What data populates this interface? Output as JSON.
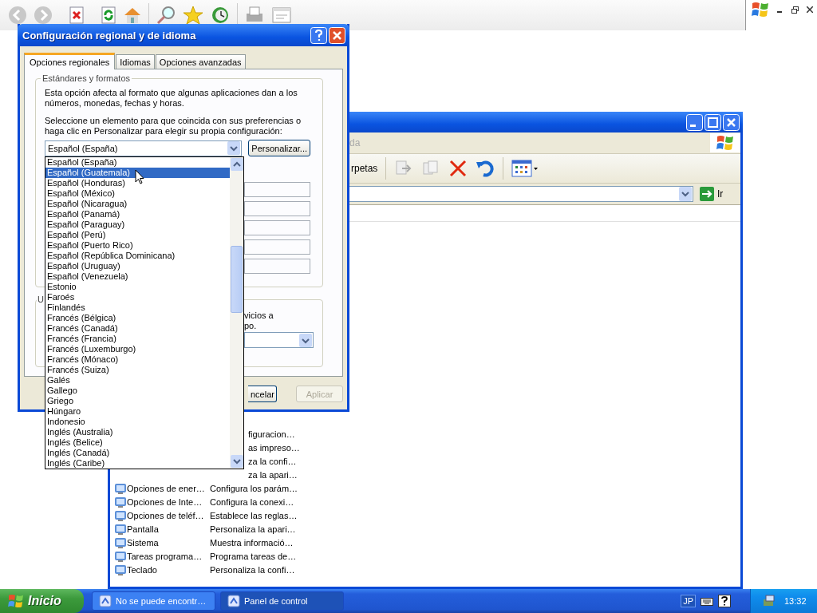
{
  "control_panel": {
    "menu_fragment": "da",
    "toolbar_fragment": "rpetas",
    "go_button": "Ir",
    "items": [
      {
        "kind": "covered",
        "description": "figuracion…"
      },
      {
        "kind": "covered",
        "description": "as impreso…"
      },
      {
        "kind": "covered",
        "description": "za la confi…"
      },
      {
        "kind": "covered",
        "description": "za la apari…"
      },
      {
        "kind": "full",
        "name": "Opciones de ener…",
        "description": "Configura los parám…"
      },
      {
        "kind": "full",
        "name": "Opciones de Inte…",
        "description": "Configura la conexi…"
      },
      {
        "kind": "full",
        "name": "Opciones de teléf…",
        "description": "Establece las reglas…"
      },
      {
        "kind": "full",
        "name": "Pantalla",
        "description": "Personaliza la apari…"
      },
      {
        "kind": "full",
        "name": "Sistema",
        "description": "Muestra informació…"
      },
      {
        "kind": "full",
        "name": "Tareas programa…",
        "description": "Programa tareas de…"
      },
      {
        "kind": "full",
        "name": "Teclado",
        "description": "Personaliza la confi…"
      }
    ]
  },
  "dialog": {
    "title": "Configuración regional y de idioma",
    "tabs": [
      {
        "label": "Opciones regionales",
        "selected": true
      },
      {
        "label": "Idiomas",
        "selected": false
      },
      {
        "label": "Opciones avanzadas",
        "selected": false
      }
    ],
    "group_title": "Estándares y formatos",
    "description": "Esta opción afecta al formato que algunas aplicaciones dan a los números, monedas, fechas y horas.",
    "instruction": "Seleccione un elemento para que coincida con sus preferencias o haga clic en Personalizar para elegir su propia configuración:",
    "locale_value": "Español (España)",
    "customize_button": "Personalizar...",
    "location_legend": "U",
    "location_text": [
      "vicios a",
      "po."
    ],
    "buttons": [
      {
        "label": "ncelar",
        "disabled": false
      },
      {
        "label": "Aplicar",
        "disabled": true
      }
    ]
  },
  "dropdown": {
    "items": [
      {
        "label": "Español (España)",
        "selected": false
      },
      {
        "label": "Español (Guatemala)",
        "selected": true
      },
      {
        "label": "Español (Honduras)",
        "selected": false
      },
      {
        "label": "Español (México)",
        "selected": false
      },
      {
        "label": "Español (Nicaragua)",
        "selected": false
      },
      {
        "label": "Español (Panamá)",
        "selected": false
      },
      {
        "label": "Español (Paraguay)",
        "selected": false
      },
      {
        "label": "Español (Perú)",
        "selected": false
      },
      {
        "label": "Español (Puerto Rico)",
        "selected": false
      },
      {
        "label": "Español (República Dominicana)",
        "selected": false
      },
      {
        "label": "Español (Uruguay)",
        "selected": false
      },
      {
        "label": "Español (Venezuela)",
        "selected": false
      },
      {
        "label": "Estonio",
        "selected": false
      },
      {
        "label": "Faroés",
        "selected": false
      },
      {
        "label": "Finlandés",
        "selected": false
      },
      {
        "label": "Francés (Bélgica)",
        "selected": false
      },
      {
        "label": "Francés (Canadá)",
        "selected": false
      },
      {
        "label": "Francés (Francia)",
        "selected": false
      },
      {
        "label": "Francés (Luxemburgo)",
        "selected": false
      },
      {
        "label": "Francés (Mónaco)",
        "selected": false
      },
      {
        "label": "Francés (Suiza)",
        "selected": false
      },
      {
        "label": "Galés",
        "selected": false
      },
      {
        "label": "Gallego",
        "selected": false
      },
      {
        "label": "Griego",
        "selected": false
      },
      {
        "label": "Húngaro",
        "selected": false
      },
      {
        "label": "Indonesio",
        "selected": false
      },
      {
        "label": "Inglés (Australia)",
        "selected": false
      },
      {
        "label": "Inglés (Belice)",
        "selected": false
      },
      {
        "label": "Inglés (Canadá)",
        "selected": false
      },
      {
        "label": "Inglés (Caribe)",
        "selected": false
      }
    ]
  },
  "taskbar": {
    "start": "Inicio",
    "tasks": [
      {
        "label": "No se puede encontr…",
        "selected": false
      },
      {
        "label": "Panel de control",
        "selected": true
      }
    ],
    "language": "JP",
    "clock": "13:32"
  }
}
